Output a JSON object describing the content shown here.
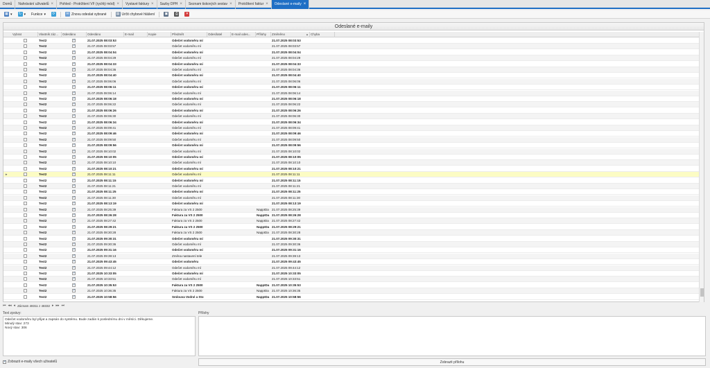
{
  "tabs": [
    {
      "label": "Domů",
      "closable": false
    },
    {
      "label": "Nahrávání uživatelů",
      "closable": true
    },
    {
      "label": "Pohled - Protržitení VF (rychlý mód)",
      "closable": true
    },
    {
      "label": "Vystavé faktury",
      "closable": true
    },
    {
      "label": "Sazby DPH",
      "closable": true
    },
    {
      "label": "Seznam tiskových sestav",
      "closable": true
    },
    {
      "label": "Protržitení faktur",
      "closable": true
    },
    {
      "label": "Odeslané e-maily",
      "closable": true,
      "active": true
    }
  ],
  "toolbar": {
    "functions_label": "Funkce",
    "resend_label": "Znovu odeslat vybrané",
    "set_error_label": "Určit chybové hlášení"
  },
  "grid": {
    "title": "Odeslané e-maily",
    "columns": [
      "Vybrat",
      "Vlastník záz...",
      "Odesláno",
      "Odesláno",
      "E-mail",
      "Kopie",
      "Předmět",
      "Odesílatel",
      "E-mail odes...",
      "Přílohy",
      "Změněno",
      "Chyba"
    ],
    "rows": [
      {
        "owner": "Test2",
        "sent": true,
        "date": "21.07.2025 08:03:53",
        "subject": "Odečet vodoměru mí",
        "att": "",
        "changed": "21.07.2025 08:03:53"
      },
      {
        "owner": "Test2",
        "sent": true,
        "date": "21.07.2025 08:03:57",
        "subject": "Odečet vodoměru mí",
        "att": "",
        "changed": "21.07.2025 08:03:57"
      },
      {
        "owner": "Test2",
        "sent": true,
        "date": "21.07.2025 08:04:04",
        "subject": "Odečet vodoměru mí",
        "att": "",
        "changed": "21.07.2025 08:04:04"
      },
      {
        "owner": "Test2",
        "sent": true,
        "date": "21.07.2025 08:04:29",
        "subject": "Odečet vodoměru mí",
        "att": "",
        "changed": "21.07.2025 08:04:29"
      },
      {
        "owner": "Test2",
        "sent": true,
        "date": "21.07.2025 08:04:33",
        "subject": "Odečet vodoměru mí",
        "att": "",
        "changed": "21.07.2025 08:04:33"
      },
      {
        "owner": "Test2",
        "sent": true,
        "date": "21.07.2025 08:04:36",
        "subject": "Odečet vodoměru mí",
        "att": "",
        "changed": "21.07.2025 08:04:36"
      },
      {
        "owner": "Test2",
        "sent": true,
        "date": "21.07.2025 08:04:40",
        "subject": "Odečet vodoměru mí",
        "att": "",
        "changed": "21.07.2025 08:04:40"
      },
      {
        "owner": "Test2",
        "sent": true,
        "date": "21.07.2025 08:06:06",
        "subject": "Odečet vodoměru mí",
        "att": "",
        "changed": "21.07.2025 08:06:06"
      },
      {
        "owner": "Test2",
        "sent": true,
        "date": "21.07.2025 08:06:11",
        "subject": "Odečet vodoměru mí",
        "att": "",
        "changed": "21.07.2025 08:06:11"
      },
      {
        "owner": "Test2",
        "sent": true,
        "date": "21.07.2025 08:06:14",
        "subject": "Odečet vodoměru mí",
        "att": "",
        "changed": "21.07.2025 08:06:14"
      },
      {
        "owner": "Test2",
        "sent": true,
        "date": "21.07.2025 08:06:18",
        "subject": "Odečet vodoměru mí",
        "att": "",
        "changed": "21.07.2025 08:06:18"
      },
      {
        "owner": "Test2",
        "sent": true,
        "date": "21.07.2025 08:06:22",
        "subject": "Odečet vodoměru mí",
        "att": "",
        "changed": "21.07.2025 08:06:22"
      },
      {
        "owner": "Test2",
        "sent": true,
        "date": "21.07.2025 08:06:26",
        "subject": "Odečet vodoměru mí",
        "att": "",
        "changed": "21.07.2025 08:06:26"
      },
      {
        "owner": "Test2",
        "sent": true,
        "date": "21.07.2025 08:06:30",
        "subject": "Odečet vodoměru mí",
        "att": "",
        "changed": "21.07.2025 08:06:30"
      },
      {
        "owner": "Test2",
        "sent": true,
        "date": "21.07.2025 08:06:34",
        "subject": "Odečet vodoměru mí",
        "att": "",
        "changed": "21.07.2025 08:06:34"
      },
      {
        "owner": "Test2",
        "sent": true,
        "date": "21.07.2025 08:09:41",
        "subject": "Odečet vodoměru mí",
        "att": "",
        "changed": "21.07.2025 08:09:41"
      },
      {
        "owner": "Test2",
        "sent": true,
        "date": "21.07.2025 08:09:46",
        "subject": "Odečet vodoměru mí",
        "att": "",
        "changed": "21.07.2025 08:09:46"
      },
      {
        "owner": "Test2",
        "sent": true,
        "date": "21.07.2025 08:09:50",
        "subject": "Odečet vodoměru mí",
        "att": "",
        "changed": "21.07.2025 08:09:50"
      },
      {
        "owner": "Test2",
        "sent": true,
        "date": "21.07.2025 08:09:56",
        "subject": "Odečet vodoměru mí",
        "att": "",
        "changed": "21.07.2025 08:09:56"
      },
      {
        "owner": "Test2",
        "sent": true,
        "date": "21.07.2025 08:10:02",
        "subject": "Odečet vodoměru mí",
        "att": "",
        "changed": "21.07.2025 08:10:02"
      },
      {
        "owner": "Test2",
        "sent": true,
        "date": "21.07.2025 08:10:05",
        "subject": "Odečet vodoměru mí",
        "att": "",
        "changed": "21.07.2025 08:10:05"
      },
      {
        "owner": "Test2",
        "sent": true,
        "date": "21.07.2025 08:10:10",
        "subject": "Odečet vodoměru mí",
        "att": "",
        "changed": "21.07.2025 08:10:10"
      },
      {
        "owner": "Test2",
        "sent": true,
        "date": "21.07.2025 08:10:21",
        "subject": "Odečet vodoměru mí",
        "att": "",
        "changed": "21.07.2025 08:10:21"
      },
      {
        "owner": "Test2",
        "sent": true,
        "date": "21.07.2025 08:11:11",
        "subject": "Odečet vodoměru mí",
        "att": "",
        "changed": "21.07.2025 08:11:11",
        "selected": true
      },
      {
        "owner": "Test2",
        "sent": true,
        "date": "21.07.2025 08:11:15",
        "subject": "Odečet vodoměru mí",
        "att": "",
        "changed": "21.07.2025 08:11:15"
      },
      {
        "owner": "Test2",
        "sent": true,
        "date": "21.07.2025 08:11:21",
        "subject": "Odečet vodoměru mí",
        "att": "",
        "changed": "21.07.2025 08:11:21"
      },
      {
        "owner": "Test2",
        "sent": true,
        "date": "21.07.2025 08:11:25",
        "subject": "Odečet vodoměru mí",
        "att": "",
        "changed": "21.07.2025 08:11:25"
      },
      {
        "owner": "Test2",
        "sent": true,
        "date": "21.07.2025 08:11:30",
        "subject": "Odečet vodoměru mí",
        "att": "",
        "changed": "21.07.2025 08:11:30"
      },
      {
        "owner": "Test2",
        "sent": true,
        "date": "21.07.2025 08:13:19",
        "subject": "Odečet vodoměru mí",
        "att": "",
        "changed": "21.07.2025 08:13:19"
      },
      {
        "owner": "Test2",
        "sent": true,
        "date": "21.07.2025 08:25:39",
        "subject": "Faktura za VS 2 2500",
        "att": "NappIDa",
        "changed": "21.07.2025 08:25:39"
      },
      {
        "owner": "Test2",
        "sent": true,
        "date": "21.07.2025 08:26:28",
        "subject": "Faktura za VS 2 2500",
        "att": "NappIDa",
        "changed": "21.07.2025 08:26:28"
      },
      {
        "owner": "Test2",
        "sent": true,
        "date": "21.07.2025 08:27:42",
        "subject": "Faktura za VS 2 2500",
        "att": "NappIDa",
        "changed": "21.07.2025 08:27:42"
      },
      {
        "owner": "Test2",
        "sent": true,
        "date": "21.07.2025 08:29:21",
        "subject": "Faktura za VS 2 2500",
        "att": "NappIDa",
        "changed": "21.07.2025 08:29:21"
      },
      {
        "owner": "Test2",
        "sent": true,
        "date": "21.07.2025 08:30:28",
        "subject": "Faktura za VS 2 2500",
        "att": "NappIDa",
        "changed": "21.07.2025 08:30:28"
      },
      {
        "owner": "Test2",
        "sent": true,
        "date": "21.07.2025 09:30:31",
        "subject": "Odečet vodoměru mí",
        "att": "",
        "changed": "21.07.2025 09:30:31"
      },
      {
        "owner": "Test2",
        "sent": true,
        "date": "21.07.2025 09:30:36",
        "subject": "Odečet vodoměru mí",
        "att": "",
        "changed": "21.07.2025 09:30:36"
      },
      {
        "owner": "Test2",
        "sent": true,
        "date": "21.07.2025 09:31:16",
        "subject": "Odečet vodoměru mí",
        "att": "",
        "changed": "21.07.2025 09:31:16"
      },
      {
        "owner": "Test2",
        "sent": true,
        "date": "21.07.2025 09:39:13",
        "subject": "Změna nastavení tele",
        "att": "",
        "changed": "21.07.2025 09:39:13"
      },
      {
        "owner": "Test2",
        "sent": true,
        "date": "21.07.2025 09:43:45",
        "subject": "Odečet vodoměru",
        "att": "",
        "changed": "21.07.2025 09:43:45"
      },
      {
        "owner": "Test2",
        "sent": true,
        "date": "21.07.2025 09:44:12",
        "subject": "Odečet vodoměru mí",
        "att": "",
        "changed": "21.07.2025 09:44:12"
      },
      {
        "owner": "Test2",
        "sent": true,
        "date": "21.07.2025 10:33:05",
        "subject": "Odečet vodoměru mí",
        "att": "",
        "changed": "21.07.2025 10:33:05"
      },
      {
        "owner": "Test2",
        "sent": true,
        "date": "21.07.2025 10:33:51",
        "subject": "Odečet vodoměru mí",
        "att": "",
        "changed": "21.07.2025 10:33:51"
      },
      {
        "owner": "Test2",
        "sent": true,
        "date": "21.07.2025 10:35:53",
        "subject": "Faktura za VS 2 2500",
        "att": "NappIDa",
        "changed": "21.07.2025 10:35:53"
      },
      {
        "owner": "Test2",
        "sent": true,
        "date": "21.07.2025 10:36:35",
        "subject": "Faktura za VS 2 2500",
        "att": "NappIDa",
        "changed": "21.07.2025 10:36:35"
      },
      {
        "owner": "Test2",
        "sent": true,
        "date": "21.07.2025 10:58:56",
        "subject": "Smlouva Vodné a Sto",
        "att": "NappIDa",
        "changed": "21.07.2025 10:58:56"
      }
    ]
  },
  "navigator": {
    "record_text": "Záznam 48311 z 48332"
  },
  "message": {
    "label": "Text zprávy:",
    "lines": [
      "Odečet vodoměru byl přijat a zapsán do systému. Bude zadán k poslednímu dni v měsíci. Děkujeme.",
      "Minulý stav:   273",
      "Nový stav:   306"
    ]
  },
  "attachments": {
    "label": "Přílohy"
  },
  "footer": {
    "show_all_label": "Zobrazit e-maily všech uživatelů",
    "show_attachment_label": "Zobrazit přílohu"
  },
  "colors": {
    "accent": "#1f6fc5",
    "selected_row": "#fcfcc4"
  }
}
